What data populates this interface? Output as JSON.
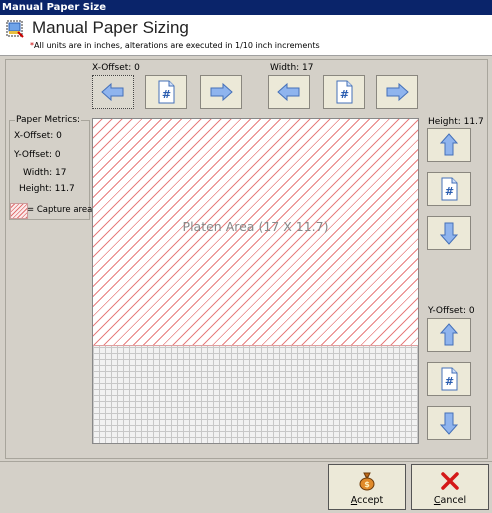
{
  "window": {
    "title": "Manual Paper Size"
  },
  "header": {
    "title": "Manual Paper Sizing",
    "note_asterisk": "*",
    "note": "All units are in inches, alterations are executed in 1/10 inch increments"
  },
  "labels": {
    "x_offset": "X-Offset: 0",
    "width": "Width: 17",
    "height": "Height: 11.7",
    "y_offset": "Y-Offset: 0"
  },
  "metrics": {
    "title": "Paper Metrics:",
    "x_offset": "X-Offset: 0",
    "y_offset": "Y-Offset: 0",
    "width": "Width: 17",
    "height": "Height: 11.7"
  },
  "legend": {
    "text": "= Capture area"
  },
  "platen": {
    "label": "Platen Area (17 X 11.7)"
  },
  "buttons": {
    "accept_first": "A",
    "accept_rest": "ccept",
    "cancel_first": "C",
    "cancel_rest": "ancel"
  },
  "colors": {
    "titlebar": "#0a246a",
    "capture_hatch": "#e87e7e",
    "arrow_fill": "#8fb4ee",
    "cancel_x": "#d41818"
  },
  "icons": {
    "left": "arrow-left-icon",
    "right": "arrow-right-icon",
    "up": "arrow-up-icon",
    "down": "arrow-down-icon",
    "reset": "number-document-icon",
    "accept": "money-bag-icon",
    "cancel": "red-x-icon"
  }
}
